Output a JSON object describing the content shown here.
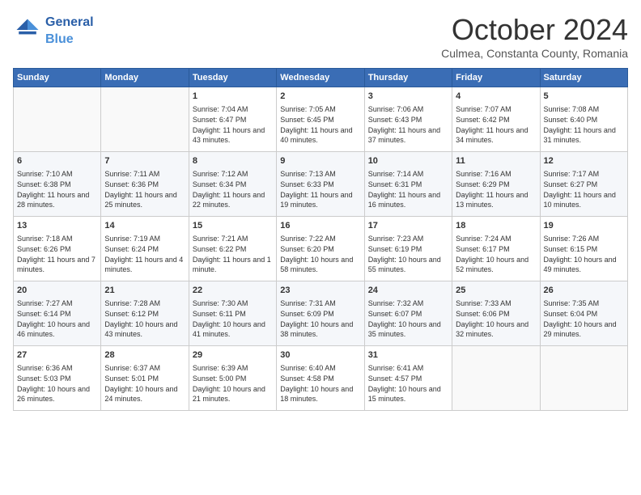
{
  "header": {
    "logo_text_general": "General",
    "logo_text_blue": "Blue",
    "month_title": "October 2024",
    "location": "Culmea, Constanta County, Romania"
  },
  "days_of_week": [
    "Sunday",
    "Monday",
    "Tuesday",
    "Wednesday",
    "Thursday",
    "Friday",
    "Saturday"
  ],
  "weeks": [
    [
      {
        "day": "",
        "info": ""
      },
      {
        "day": "",
        "info": ""
      },
      {
        "day": "1",
        "info": "Sunrise: 7:04 AM\nSunset: 6:47 PM\nDaylight: 11 hours and 43 minutes."
      },
      {
        "day": "2",
        "info": "Sunrise: 7:05 AM\nSunset: 6:45 PM\nDaylight: 11 hours and 40 minutes."
      },
      {
        "day": "3",
        "info": "Sunrise: 7:06 AM\nSunset: 6:43 PM\nDaylight: 11 hours and 37 minutes."
      },
      {
        "day": "4",
        "info": "Sunrise: 7:07 AM\nSunset: 6:42 PM\nDaylight: 11 hours and 34 minutes."
      },
      {
        "day": "5",
        "info": "Sunrise: 7:08 AM\nSunset: 6:40 PM\nDaylight: 11 hours and 31 minutes."
      }
    ],
    [
      {
        "day": "6",
        "info": "Sunrise: 7:10 AM\nSunset: 6:38 PM\nDaylight: 11 hours and 28 minutes."
      },
      {
        "day": "7",
        "info": "Sunrise: 7:11 AM\nSunset: 6:36 PM\nDaylight: 11 hours and 25 minutes."
      },
      {
        "day": "8",
        "info": "Sunrise: 7:12 AM\nSunset: 6:34 PM\nDaylight: 11 hours and 22 minutes."
      },
      {
        "day": "9",
        "info": "Sunrise: 7:13 AM\nSunset: 6:33 PM\nDaylight: 11 hours and 19 minutes."
      },
      {
        "day": "10",
        "info": "Sunrise: 7:14 AM\nSunset: 6:31 PM\nDaylight: 11 hours and 16 minutes."
      },
      {
        "day": "11",
        "info": "Sunrise: 7:16 AM\nSunset: 6:29 PM\nDaylight: 11 hours and 13 minutes."
      },
      {
        "day": "12",
        "info": "Sunrise: 7:17 AM\nSunset: 6:27 PM\nDaylight: 11 hours and 10 minutes."
      }
    ],
    [
      {
        "day": "13",
        "info": "Sunrise: 7:18 AM\nSunset: 6:26 PM\nDaylight: 11 hours and 7 minutes."
      },
      {
        "day": "14",
        "info": "Sunrise: 7:19 AM\nSunset: 6:24 PM\nDaylight: 11 hours and 4 minutes."
      },
      {
        "day": "15",
        "info": "Sunrise: 7:21 AM\nSunset: 6:22 PM\nDaylight: 11 hours and 1 minute."
      },
      {
        "day": "16",
        "info": "Sunrise: 7:22 AM\nSunset: 6:20 PM\nDaylight: 10 hours and 58 minutes."
      },
      {
        "day": "17",
        "info": "Sunrise: 7:23 AM\nSunset: 6:19 PM\nDaylight: 10 hours and 55 minutes."
      },
      {
        "day": "18",
        "info": "Sunrise: 7:24 AM\nSunset: 6:17 PM\nDaylight: 10 hours and 52 minutes."
      },
      {
        "day": "19",
        "info": "Sunrise: 7:26 AM\nSunset: 6:15 PM\nDaylight: 10 hours and 49 minutes."
      }
    ],
    [
      {
        "day": "20",
        "info": "Sunrise: 7:27 AM\nSunset: 6:14 PM\nDaylight: 10 hours and 46 minutes."
      },
      {
        "day": "21",
        "info": "Sunrise: 7:28 AM\nSunset: 6:12 PM\nDaylight: 10 hours and 43 minutes."
      },
      {
        "day": "22",
        "info": "Sunrise: 7:30 AM\nSunset: 6:11 PM\nDaylight: 10 hours and 41 minutes."
      },
      {
        "day": "23",
        "info": "Sunrise: 7:31 AM\nSunset: 6:09 PM\nDaylight: 10 hours and 38 minutes."
      },
      {
        "day": "24",
        "info": "Sunrise: 7:32 AM\nSunset: 6:07 PM\nDaylight: 10 hours and 35 minutes."
      },
      {
        "day": "25",
        "info": "Sunrise: 7:33 AM\nSunset: 6:06 PM\nDaylight: 10 hours and 32 minutes."
      },
      {
        "day": "26",
        "info": "Sunrise: 7:35 AM\nSunset: 6:04 PM\nDaylight: 10 hours and 29 minutes."
      }
    ],
    [
      {
        "day": "27",
        "info": "Sunrise: 6:36 AM\nSunset: 5:03 PM\nDaylight: 10 hours and 26 minutes."
      },
      {
        "day": "28",
        "info": "Sunrise: 6:37 AM\nSunset: 5:01 PM\nDaylight: 10 hours and 24 minutes."
      },
      {
        "day": "29",
        "info": "Sunrise: 6:39 AM\nSunset: 5:00 PM\nDaylight: 10 hours and 21 minutes."
      },
      {
        "day": "30",
        "info": "Sunrise: 6:40 AM\nSunset: 4:58 PM\nDaylight: 10 hours and 18 minutes."
      },
      {
        "day": "31",
        "info": "Sunrise: 6:41 AM\nSunset: 4:57 PM\nDaylight: 10 hours and 15 minutes."
      },
      {
        "day": "",
        "info": ""
      },
      {
        "day": "",
        "info": ""
      }
    ]
  ]
}
